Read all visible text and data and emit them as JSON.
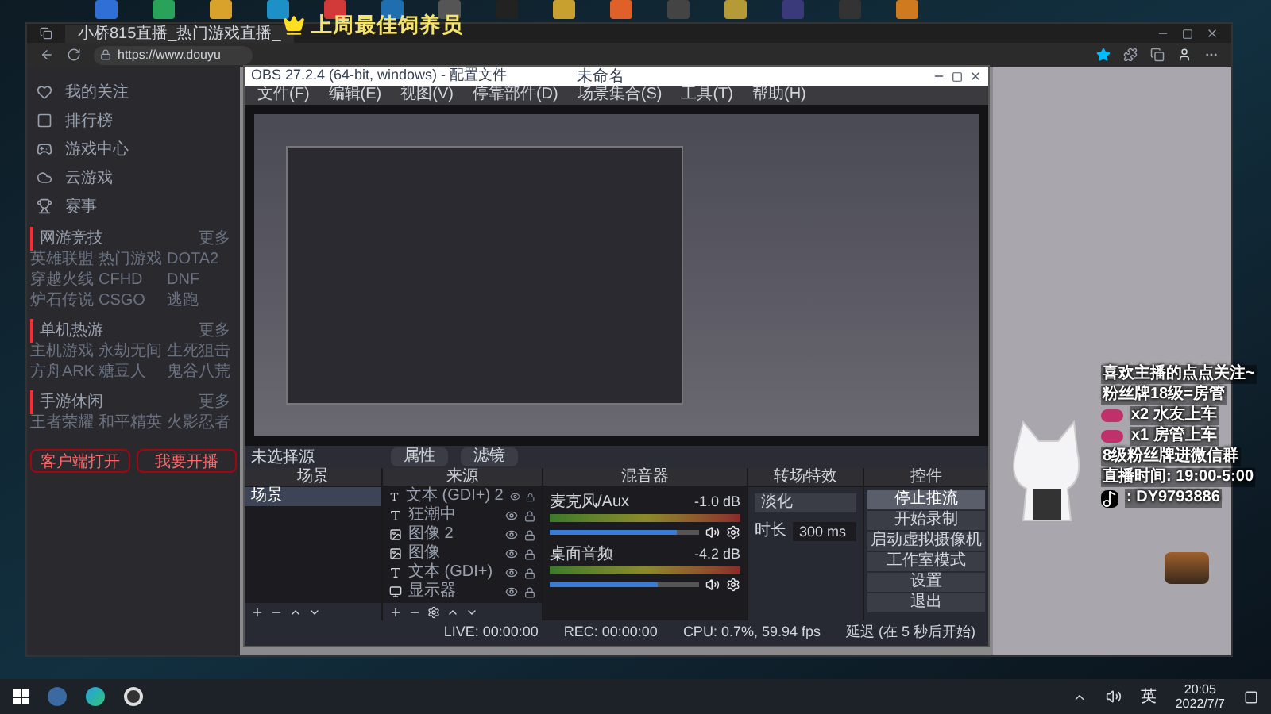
{
  "banner": {
    "title": "上周最佳饲养员"
  },
  "browser": {
    "tab_title": "小桥815直播_热门游戏直播_",
    "url": "https://www.douyu"
  },
  "sidebar": {
    "nav": [
      {
        "label": "我的关注",
        "kind": "heart"
      },
      {
        "label": "排行榜",
        "kind": "rank"
      },
      {
        "label": "游戏中心",
        "kind": "game"
      },
      {
        "label": "云游戏",
        "kind": "cloud"
      },
      {
        "label": "赛事",
        "kind": "trophy"
      }
    ],
    "sections": [
      {
        "title": "网游竞技",
        "more": "更多",
        "games": [
          "英雄联盟",
          "热门游戏",
          "DOTA2",
          "穿越火线",
          "CFHD",
          "DNF",
          "炉石传说",
          "CSGO",
          "逃跑"
        ]
      },
      {
        "title": "单机热游",
        "more": "更多",
        "games": [
          "主机游戏",
          "永劫无间",
          "生死狙击",
          "方舟ARK",
          "糖豆人",
          "鬼谷八荒"
        ]
      },
      {
        "title": "手游休闲",
        "more": "更多",
        "games": [
          "王者荣耀",
          "和平精英",
          "火影忍者"
        ]
      }
    ],
    "buttons": [
      "客户端打开",
      "我要开播"
    ]
  },
  "obs": {
    "title": "OBS 27.2.4 (64-bit, windows) - 配置文件",
    "title_tail": "未命名",
    "menu": [
      "文件(F)",
      "编辑(E)",
      "视图(V)",
      "停靠部件(D)",
      "场景集合(S)",
      "工具(T)",
      "帮助(H)"
    ],
    "source_bar": {
      "label": "未选择源",
      "buttons": [
        "属性",
        "滤镜"
      ]
    },
    "docks": {
      "scenes": "场景",
      "sources": "来源",
      "mixer": "混音器",
      "transitions": "转场特效",
      "controls": "控件"
    },
    "scenes": [
      {
        "name": "场景",
        "selected": true
      }
    ],
    "sources": [
      {
        "name": "文本 (GDI+) 2",
        "kind": "text"
      },
      {
        "name": "狂潮中",
        "kind": "text"
      },
      {
        "name": "图像 2",
        "kind": "image"
      },
      {
        "name": "图像",
        "kind": "image"
      },
      {
        "name": "文本 (GDI+)",
        "kind": "text"
      },
      {
        "name": "显示器",
        "kind": "display"
      }
    ],
    "mixer": [
      {
        "name": "麦克风/Aux",
        "reading": "-1.0 dB",
        "level": 0.85
      },
      {
        "name": "桌面音频",
        "reading": "-4.2 dB",
        "level": 0.72
      }
    ],
    "transition": {
      "value": "淡化",
      "duration_label": "时长",
      "duration": "300 ms"
    },
    "controls": [
      {
        "label": "停止推流",
        "selected": true
      },
      {
        "label": "开始录制",
        "selected": false
      },
      {
        "label": "启动虚拟摄像机",
        "selected": false
      },
      {
        "label": "工作室模式",
        "selected": false
      },
      {
        "label": "设置",
        "selected": false
      },
      {
        "label": "退出",
        "selected": false
      }
    ],
    "status": {
      "live": "LIVE: 00:00:00",
      "rec": "REC: 00:00:00",
      "cpu": "CPU: 0.7%, 59.94 fps",
      "delay": "延迟 (在 5 秒后开始)"
    }
  },
  "overlay": {
    "lines": [
      {
        "text": "喜欢主播的点点关注~",
        "kind": "plain"
      },
      {
        "text": "粉丝牌18级=房管",
        "kind": "plain"
      },
      {
        "text": "x2 水友上车",
        "kind": "badge"
      },
      {
        "text": "x1 房管上车",
        "kind": "badge"
      },
      {
        "text": "8级粉丝牌进微信群",
        "kind": "plain"
      },
      {
        "text": "直播时间: 19:00-5:00",
        "kind": "plain"
      },
      {
        "text": ": DY9793886",
        "kind": "tiktok"
      }
    ]
  },
  "taskbar": {
    "language": "英",
    "time": "20:05",
    "date": "2022/7/7"
  }
}
